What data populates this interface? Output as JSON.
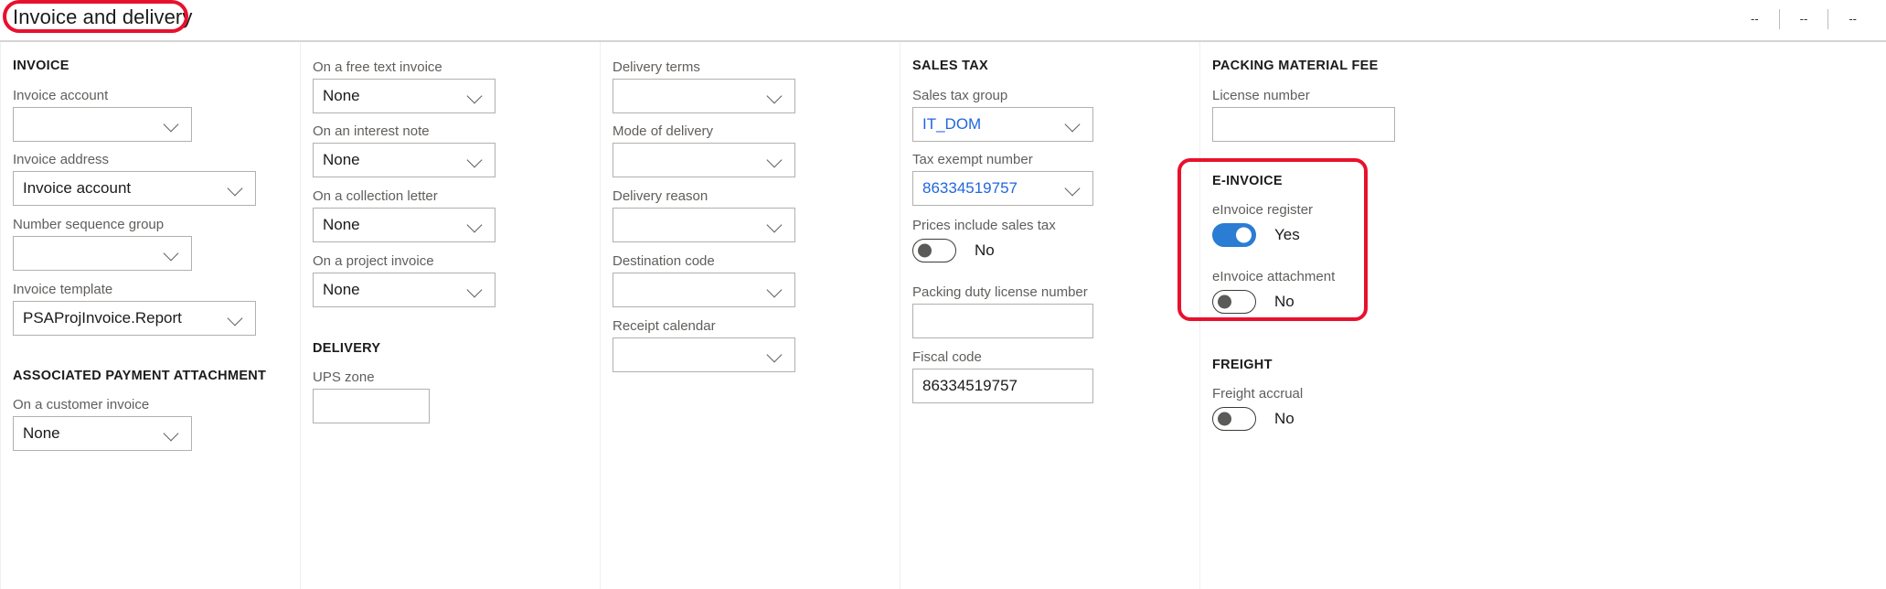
{
  "header": {
    "title": "Invoice and delivery",
    "right_items": [
      "--",
      "--",
      "--"
    ]
  },
  "columns": {
    "invoice": {
      "group_title": "INVOICE",
      "fields": [
        {
          "label": "Invoice account",
          "value": "",
          "type": "lookup"
        },
        {
          "label": "Invoice address",
          "value": "Invoice account",
          "type": "lookup"
        },
        {
          "label": "Number sequence group",
          "value": "",
          "type": "lookup"
        },
        {
          "label": "Invoice template",
          "value": "PSAProjInvoice.Report",
          "type": "lookup"
        }
      ],
      "group2_title": "ASSOCIATED PAYMENT ATTACHMENT",
      "fields2": [
        {
          "label": "On a customer invoice",
          "value": "None",
          "type": "lookup"
        }
      ]
    },
    "attachments": {
      "fields": [
        {
          "label": "On a free text invoice",
          "value": "None",
          "type": "lookup"
        },
        {
          "label": "On an interest note",
          "value": "None",
          "type": "lookup"
        },
        {
          "label": "On a collection letter",
          "value": "None",
          "type": "lookup"
        },
        {
          "label": "On a project invoice",
          "value": "None",
          "type": "lookup"
        }
      ],
      "group2_title": "DELIVERY",
      "fields2": [
        {
          "label": "UPS zone",
          "value": "",
          "type": "text"
        }
      ]
    },
    "delivery": {
      "fields": [
        {
          "label": "Delivery terms",
          "value": "",
          "type": "lookup"
        },
        {
          "label": "Mode of delivery",
          "value": "",
          "type": "lookup"
        },
        {
          "label": "Delivery reason",
          "value": "",
          "type": "lookup"
        },
        {
          "label": "Destination code",
          "value": "",
          "type": "lookup"
        },
        {
          "label": "Receipt calendar",
          "value": "",
          "type": "lookup"
        }
      ]
    },
    "sales_tax": {
      "group_title": "SALES TAX",
      "fields": [
        {
          "label": "Sales tax group",
          "value": "IT_DOM",
          "type": "lookup",
          "link": true
        },
        {
          "label": "Tax exempt number",
          "value": "86334519757",
          "type": "lookup",
          "link": true
        }
      ],
      "toggle": {
        "label": "Prices include sales tax",
        "state": "No",
        "on": false
      },
      "fields2": [
        {
          "label": "Packing duty license number",
          "value": "",
          "type": "text"
        },
        {
          "label": "Fiscal code",
          "value": "86334519757",
          "type": "text"
        }
      ]
    },
    "packing": {
      "group_title": "PACKING MATERIAL FEE",
      "fields": [
        {
          "label": "License number",
          "value": "",
          "type": "text"
        }
      ],
      "einvoice_title": "E-INVOICE",
      "einvoice_toggles": [
        {
          "label": "eInvoice register",
          "state": "Yes",
          "on": true
        },
        {
          "label": "eInvoice attachment",
          "state": "No",
          "on": false
        }
      ],
      "freight_title": "FREIGHT",
      "freight_toggle": {
        "label": "Freight accrual",
        "state": "No",
        "on": false
      }
    }
  },
  "annotations": {
    "color": "#e8112d",
    "title_highlight": "Invoice and delivery",
    "einvoice_highlight": "E-INVOICE"
  }
}
